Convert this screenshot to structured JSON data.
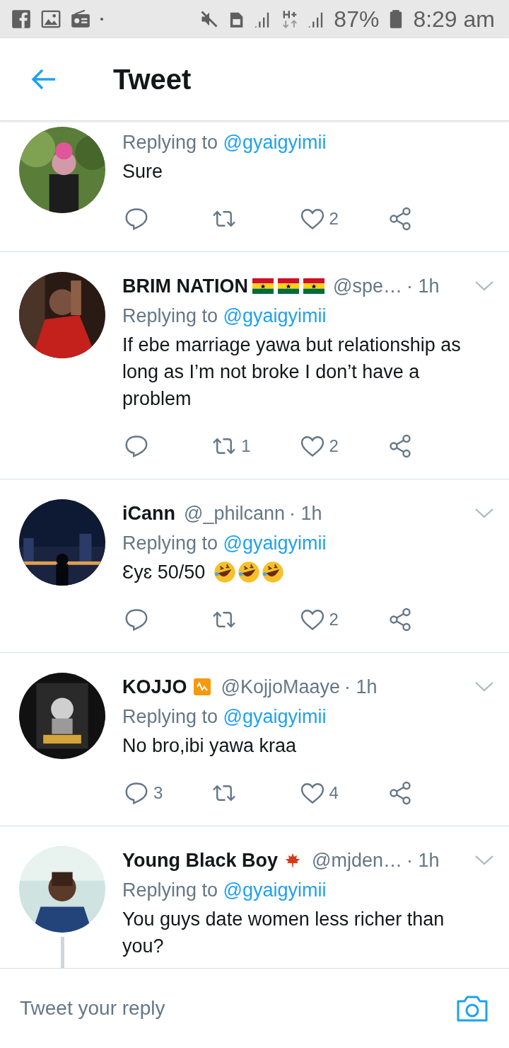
{
  "status_bar": {
    "battery": "87%",
    "time": "8:29 am"
  },
  "header": {
    "title": "Tweet"
  },
  "tweets": [
    {
      "replying_label": "Replying to",
      "replying_to": "@gyaigyimii",
      "text": "Sure",
      "likes": "2",
      "thread": false
    },
    {
      "name": "BRIM NATION",
      "name_icons": [
        {
          "kind": "flag"
        },
        {
          "kind": "flag"
        },
        {
          "kind": "flag"
        }
      ],
      "handle": "@spe…",
      "time": "· 1h",
      "replying_label": "Replying to",
      "replying_to": "@gyaigyimii",
      "text": "If ebe marriage yawa but relationship as long as I’m not broke I don’t have a problem",
      "retweets": "1",
      "likes": "2",
      "thread": false
    },
    {
      "name": "iCann",
      "handle": "@_philcann",
      "time": "· 1h",
      "replying_label": "Replying to",
      "replying_to": "@gyaigyimii",
      "text": "Ɛyɛ 50/50",
      "emoji": [
        {
          "kind": "laugh"
        },
        {
          "kind": "laugh"
        },
        {
          "kind": "laugh"
        }
      ],
      "likes": "2",
      "thread": false
    },
    {
      "name": "KOJJO",
      "name_icons": [
        {
          "kind": "chart"
        }
      ],
      "handle": "@KojjoMaaye",
      "time": "· 1h",
      "replying_label": "Replying to",
      "replying_to": "@gyaigyimii",
      "text": "No bro,ibi yawa kraa",
      "replies": "3",
      "likes": "4",
      "thread": false
    },
    {
      "name": "Young Black Boy",
      "name_icons": [
        {
          "kind": "leaf"
        }
      ],
      "handle": "@mjden…",
      "time": "· 1h",
      "replying_label": "Replying to",
      "replying_to": "@gyaigyimii",
      "text": "You guys date women less richer than you?",
      "thread": true
    }
  ],
  "reply_bar": {
    "placeholder": "Tweet your reply"
  }
}
